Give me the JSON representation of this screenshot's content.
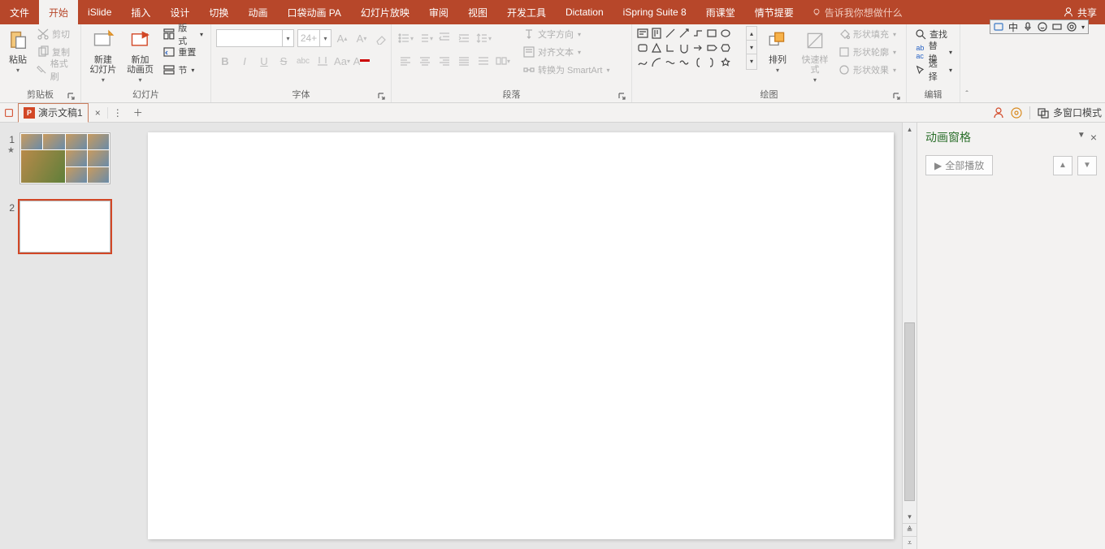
{
  "tabs": {
    "file": "文件",
    "home": "开始",
    "islide": "iSlide",
    "insert": "插入",
    "design": "设计",
    "transition": "切换",
    "animation": "动画",
    "pocket_anim": "口袋动画 PA",
    "slideshow": "幻灯片放映",
    "review": "审阅",
    "view": "视图",
    "developer": "开发工具",
    "dictation": "Dictation",
    "ispring": "iSpring Suite 8",
    "rainclass": "雨课堂",
    "plot": "情节提要"
  },
  "tell_me": "告诉我你想做什么",
  "share": "共享",
  "clipboard": {
    "paste": "粘贴",
    "cut": "剪切",
    "copy": "复制",
    "format_painter": "格式刷",
    "group": "剪贴板"
  },
  "slides": {
    "new_slide": "新建\n幻灯片",
    "new_page": "新加\n动画页",
    "layout": "版式",
    "reset": "重置",
    "section": "节",
    "group": "幻灯片"
  },
  "font": {
    "size": "24+",
    "group": "字体"
  },
  "paragraph": {
    "text_direction": "文字方向",
    "align_text": "对齐文本",
    "smartart": "转换为 SmartArt",
    "group": "段落"
  },
  "drawing": {
    "arrange": "排列",
    "quick_styles": "快速样式",
    "shape_fill": "形状填充",
    "shape_outline": "形状轮廓",
    "shape_effects": "形状效果",
    "group": "绘图"
  },
  "editing": {
    "find": "查找",
    "replace": "替换",
    "select": "选择",
    "group": "编辑"
  },
  "document": {
    "name": "演示文稿1"
  },
  "multi_window": "多窗口模式",
  "anim_pane": {
    "title": "动画窗格",
    "play_all": "全部播放"
  },
  "thumbs": {
    "n1": "1",
    "n2": "2",
    "star": "★"
  },
  "ime": {
    "lang": "中"
  }
}
